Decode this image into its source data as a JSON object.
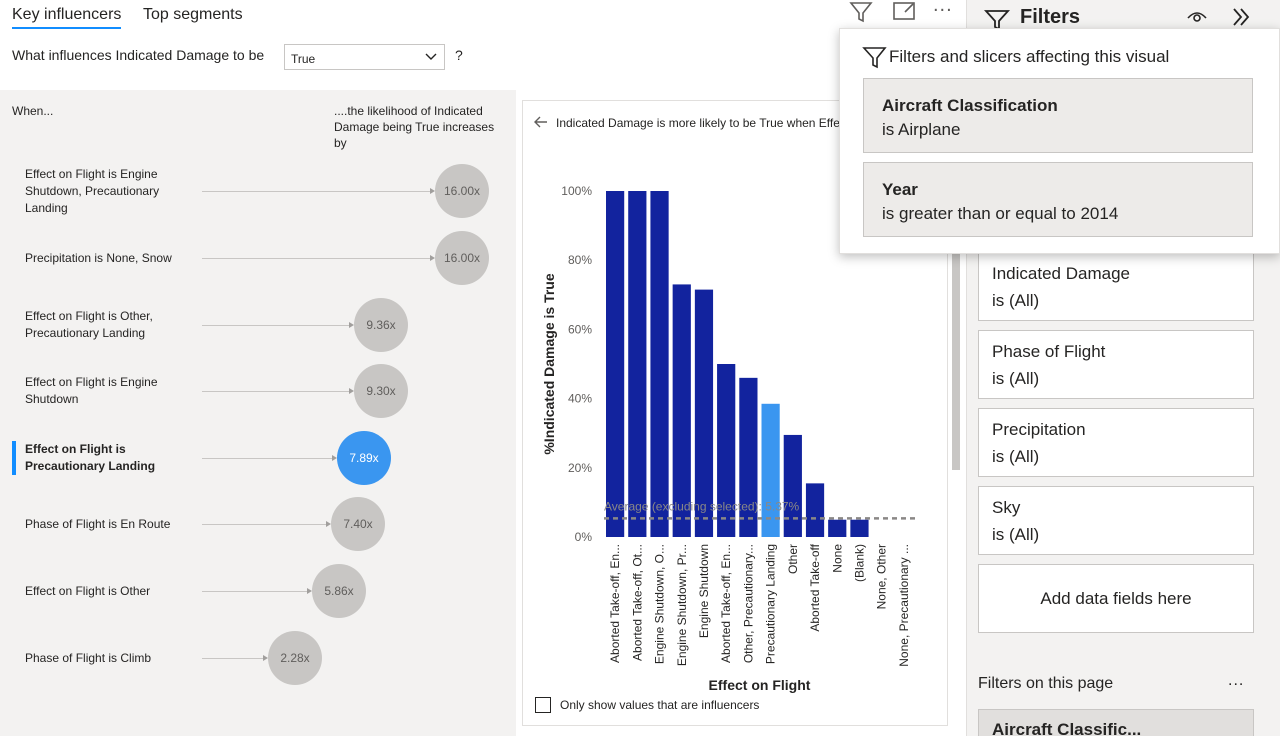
{
  "tabs": {
    "key_influencers": "Key influencers",
    "top_segments": "Top segments"
  },
  "question": {
    "label": "What influences Indicated Damage to be",
    "value": "True",
    "help": "?"
  },
  "left": {
    "when": "When...",
    "likelihood": "....the likelihood of Indicated Damage being True increases by",
    "influencers": [
      {
        "label": "Effect on Flight is Engine Shutdown, Precautionary Landing",
        "value": "16.00x"
      },
      {
        "label": "Precipitation is None, Snow",
        "value": "16.00x"
      },
      {
        "label": "Effect on Flight is Other, Precautionary Landing",
        "value": "9.36x"
      },
      {
        "label": "Effect on Flight is Engine Shutdown",
        "value": "9.30x"
      },
      {
        "label": "Effect on Flight is Precautionary Landing",
        "value": "7.89x"
      },
      {
        "label": "Phase of Flight is En Route",
        "value": "7.40x"
      },
      {
        "label": "Effect on Flight is Other",
        "value": "5.86x"
      },
      {
        "label": "Phase of Flight is Climb",
        "value": "2.28x"
      }
    ]
  },
  "chart_panel": {
    "description": "Indicated Damage is more likely to be True when Effect on Flight is Precautionary Landing than otherwise (on average).",
    "checkbox_label": "Only show values that are influencers"
  },
  "chart_data": {
    "type": "bar",
    "categories": [
      "Aborted Take-off, En...",
      "Aborted Take-off, Ot...",
      "Engine Shutdown, O...",
      "Engine Shutdown, Pr...",
      "Engine Shutdown",
      "Aborted Take-off, En...",
      "Other, Precautionary...",
      "Precautionary Landing",
      "Other",
      "Aborted Take-off",
      "None",
      "(Blank)",
      "None, Other",
      "None, Precautionary ..."
    ],
    "values": [
      100,
      100,
      100,
      73,
      71.5,
      50,
      46,
      38.5,
      29.5,
      15.5,
      5,
      5,
      0,
      0
    ],
    "selected_index": 7,
    "xlabel": "Effect on Flight",
    "ylabel": "%Indicated Damage is True",
    "ylim": [
      0,
      100
    ],
    "yticks": [
      "0%",
      "20%",
      "40%",
      "60%",
      "80%",
      "100%"
    ],
    "average_label": "Average (excluding selected): 5.37%",
    "average_value": 5.37,
    "colors": {
      "bar": "#12239e",
      "selected": "#3a96f0",
      "average": "#8a8886"
    }
  },
  "filters": {
    "title": "Filters",
    "cards": [
      {
        "name": "Indicated Damage",
        "cond": "is (All)"
      },
      {
        "name": "Phase of Flight",
        "cond": "is (All)"
      },
      {
        "name": "Precipitation",
        "cond": "is (All)"
      },
      {
        "name": "Sky",
        "cond": "is (All)"
      }
    ],
    "add_fields": "Add data fields here",
    "page_section": "Filters on this page",
    "more": "...",
    "page_card": "Aircraft Classific..."
  },
  "popup": {
    "title": "Filters and slicers affecting this visual",
    "cards": [
      {
        "name": "Aircraft Classification",
        "cond": "is Airplane"
      },
      {
        "name": "Year",
        "cond": "is greater than or equal to 2014"
      }
    ]
  },
  "top_icons": {
    "more": "..."
  }
}
